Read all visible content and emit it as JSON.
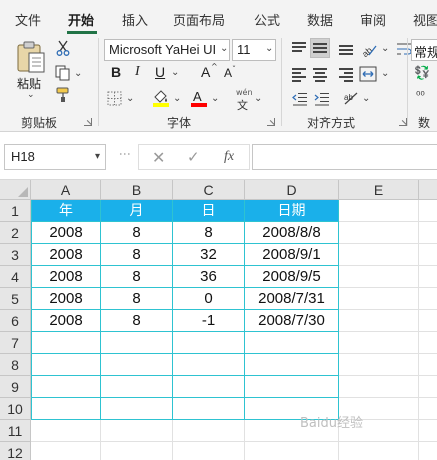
{
  "ribbon_tabs": [
    "文件",
    "开始",
    "插入",
    "页面布局",
    "公式",
    "数据",
    "审阅",
    "视图"
  ],
  "active_tab": "开始",
  "clipboard": {
    "paste_label": "粘贴",
    "group_label": "剪贴板"
  },
  "font": {
    "name": "Microsoft YaHei UI",
    "size": "11",
    "bold": "B",
    "italic": "I",
    "underline": "U",
    "grow": "A",
    "shrink": "A",
    "phonetic_top": "wén",
    "phonetic_bottom": "文",
    "group_label": "字体",
    "fill_color": "#ffff00",
    "font_color": "#ff0000"
  },
  "alignment": {
    "group_label": "对齐方式"
  },
  "number": {
    "format": "常规",
    "group_label": "数"
  },
  "formula_bar": {
    "name_box": "H18",
    "cancel": "✕",
    "enter": "✓",
    "fx": "fx",
    "content": ""
  },
  "columns": [
    "A",
    "B",
    "C",
    "D",
    "E"
  ],
  "rows": [
    "1",
    "2",
    "3",
    "4",
    "5",
    "6",
    "7",
    "8",
    "9",
    "10",
    "11",
    "12"
  ],
  "table": {
    "headers": [
      "年",
      "月",
      "日",
      "日期"
    ],
    "rows": [
      [
        "2008",
        "8",
        "8",
        "2008/8/8"
      ],
      [
        "2008",
        "8",
        "32",
        "2008/9/1"
      ],
      [
        "2008",
        "8",
        "36",
        "2008/9/5"
      ],
      [
        "2008",
        "8",
        "0",
        "2008/7/31"
      ],
      [
        "2008",
        "8",
        "-1",
        "2008/7/30"
      ]
    ],
    "header_color": "#1ab0ea",
    "border_color": "#2ec3d1"
  },
  "watermark": "Baidu经验"
}
